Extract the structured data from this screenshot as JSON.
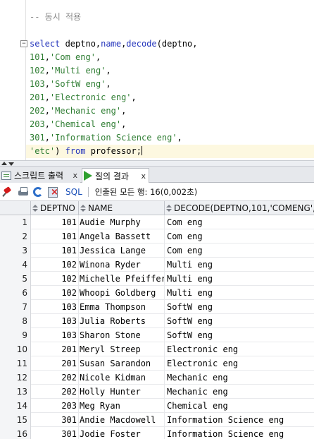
{
  "editor": {
    "comment": "-- 동시 적용",
    "fold_symbol": "−",
    "lines": [
      {
        "parts": [
          [
            "kw",
            "select "
          ],
          [
            "txt",
            "deptno,"
          ],
          [
            "kw",
            "name"
          ],
          [
            "txt",
            ","
          ],
          [
            "kw",
            "decode"
          ],
          [
            "txt",
            "(deptno,"
          ]
        ]
      },
      {
        "parts": [
          [
            "num",
            "101"
          ],
          [
            "txt",
            ","
          ],
          [
            "str",
            "'Com eng'"
          ],
          [
            "txt",
            ","
          ]
        ]
      },
      {
        "parts": [
          [
            "num",
            "102"
          ],
          [
            "txt",
            ","
          ],
          [
            "str",
            "'Multi eng'"
          ],
          [
            "txt",
            ","
          ]
        ]
      },
      {
        "parts": [
          [
            "num",
            "103"
          ],
          [
            "txt",
            ","
          ],
          [
            "str",
            "'SoftW eng'"
          ],
          [
            "txt",
            ","
          ]
        ]
      },
      {
        "parts": [
          [
            "num",
            "201"
          ],
          [
            "txt",
            ","
          ],
          [
            "str",
            "'Electronic eng'"
          ],
          [
            "txt",
            ","
          ]
        ]
      },
      {
        "parts": [
          [
            "num",
            "202"
          ],
          [
            "txt",
            ","
          ],
          [
            "str",
            "'Mechanic eng'"
          ],
          [
            "txt",
            ","
          ]
        ]
      },
      {
        "parts": [
          [
            "num",
            "203"
          ],
          [
            "txt",
            ","
          ],
          [
            "str",
            "'Chemical eng'"
          ],
          [
            "txt",
            ","
          ]
        ]
      },
      {
        "parts": [
          [
            "num",
            "301"
          ],
          [
            "txt",
            ","
          ],
          [
            "str",
            "'Information Science eng'"
          ],
          [
            "txt",
            ","
          ]
        ]
      },
      {
        "parts": [
          [
            "str",
            "'etc'"
          ],
          [
            "txt",
            ") "
          ],
          [
            "kw",
            "from"
          ],
          [
            "txt",
            " professor;"
          ]
        ]
      }
    ]
  },
  "tabs": {
    "script_output": "스크립트 출력",
    "query_result": "질의 결과",
    "close": "x"
  },
  "toolbar": {
    "sql_label": "SQL",
    "status": "인출된 모든 행: 16(0,002초)"
  },
  "grid": {
    "headers": {
      "deptno": "DEPTNO",
      "name": "NAME",
      "decode": "DECODE(DEPTNO,101,'COMENG',"
    },
    "rows": [
      {
        "n": "1",
        "deptno": "101",
        "name": "Audie Murphy",
        "decode": "Com eng"
      },
      {
        "n": "2",
        "deptno": "101",
        "name": "Angela Bassett",
        "decode": "Com eng"
      },
      {
        "n": "3",
        "deptno": "101",
        "name": "Jessica Lange",
        "decode": "Com eng"
      },
      {
        "n": "4",
        "deptno": "102",
        "name": "Winona Ryder",
        "decode": "Multi eng"
      },
      {
        "n": "5",
        "deptno": "102",
        "name": "Michelle Pfeiffer",
        "decode": "Multi eng"
      },
      {
        "n": "6",
        "deptno": "102",
        "name": "Whoopi Goldberg",
        "decode": "Multi eng"
      },
      {
        "n": "7",
        "deptno": "103",
        "name": "Emma Thompson",
        "decode": "SoftW eng"
      },
      {
        "n": "8",
        "deptno": "103",
        "name": "Julia Roberts",
        "decode": "SoftW eng"
      },
      {
        "n": "9",
        "deptno": "103",
        "name": "Sharon Stone",
        "decode": "SoftW eng"
      },
      {
        "n": "10",
        "deptno": "201",
        "name": "Meryl Streep",
        "decode": "Electronic eng"
      },
      {
        "n": "11",
        "deptno": "201",
        "name": "Susan Sarandon",
        "decode": "Electronic eng"
      },
      {
        "n": "12",
        "deptno": "202",
        "name": "Nicole Kidman",
        "decode": "Mechanic eng"
      },
      {
        "n": "13",
        "deptno": "202",
        "name": "Holly Hunter",
        "decode": "Mechanic eng"
      },
      {
        "n": "14",
        "deptno": "203",
        "name": "Meg Ryan",
        "decode": "Chemical eng"
      },
      {
        "n": "15",
        "deptno": "301",
        "name": "Andie Macdowell",
        "decode": "Information Science eng"
      },
      {
        "n": "16",
        "deptno": "301",
        "name": "Jodie Foster",
        "decode": "Information Science eng"
      }
    ]
  }
}
